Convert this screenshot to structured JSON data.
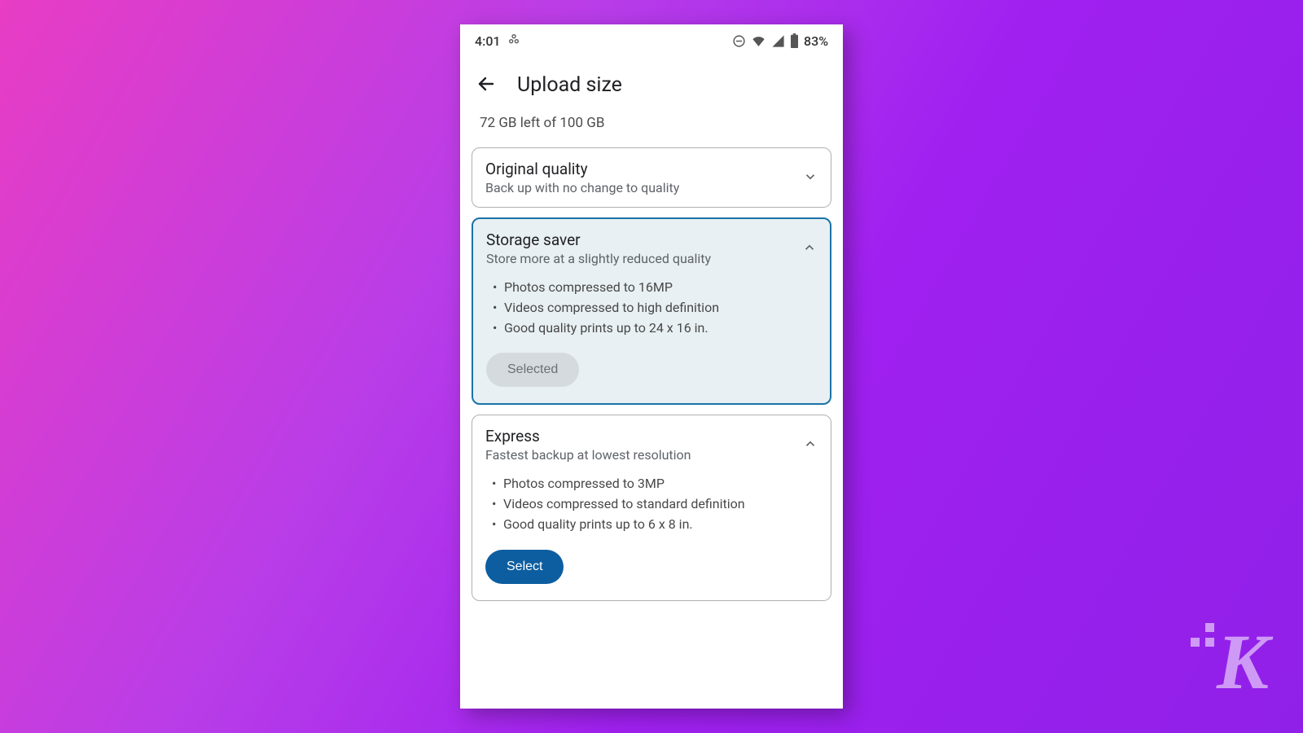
{
  "status_bar": {
    "time": "4:01",
    "battery": "83%"
  },
  "header": {
    "title": "Upload size"
  },
  "storage_text": "72 GB left of 100 GB",
  "options": {
    "original": {
      "title": "Original quality",
      "subtitle": "Back up with no change to quality"
    },
    "storage_saver": {
      "title": "Storage saver",
      "subtitle": "Store more at a slightly reduced quality",
      "bullet1": "Photos compressed to 16MP",
      "bullet2": "Videos compressed to high definition",
      "bullet3": "Good quality prints up to 24 x 16 in.",
      "button": "Selected"
    },
    "express": {
      "title": "Express",
      "subtitle": "Fastest backup at lowest resolution",
      "bullet1": "Photos compressed to 3MP",
      "bullet2": "Videos compressed to standard definition",
      "bullet3": "Good quality prints up to 6 x 8 in.",
      "button": "Select"
    }
  },
  "watermark": "K"
}
